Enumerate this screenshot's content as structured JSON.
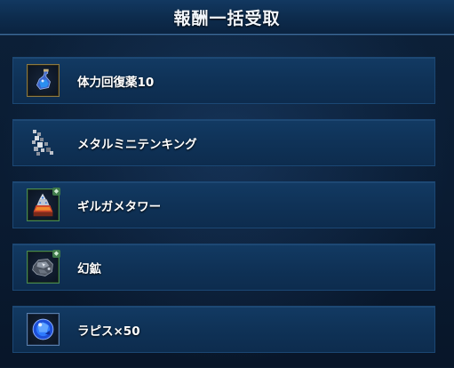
{
  "header": {
    "title": "報酬一括受取"
  },
  "rewards": [
    {
      "name": "体力回復薬10",
      "icon": "potion-icon"
    },
    {
      "name": "メタルミニテンキング",
      "icon": "metal-king-icon"
    },
    {
      "name": "ギルガメタワー",
      "icon": "gilgame-tower-icon"
    },
    {
      "name": "幻鉱",
      "icon": "ore-icon"
    },
    {
      "name": "ラピス×50",
      "icon": "lapis-icon"
    }
  ],
  "colors": {
    "background": "#0a1a2e",
    "row": "#0f3257",
    "header": "#0d2b4c",
    "text": "#ffffff"
  }
}
